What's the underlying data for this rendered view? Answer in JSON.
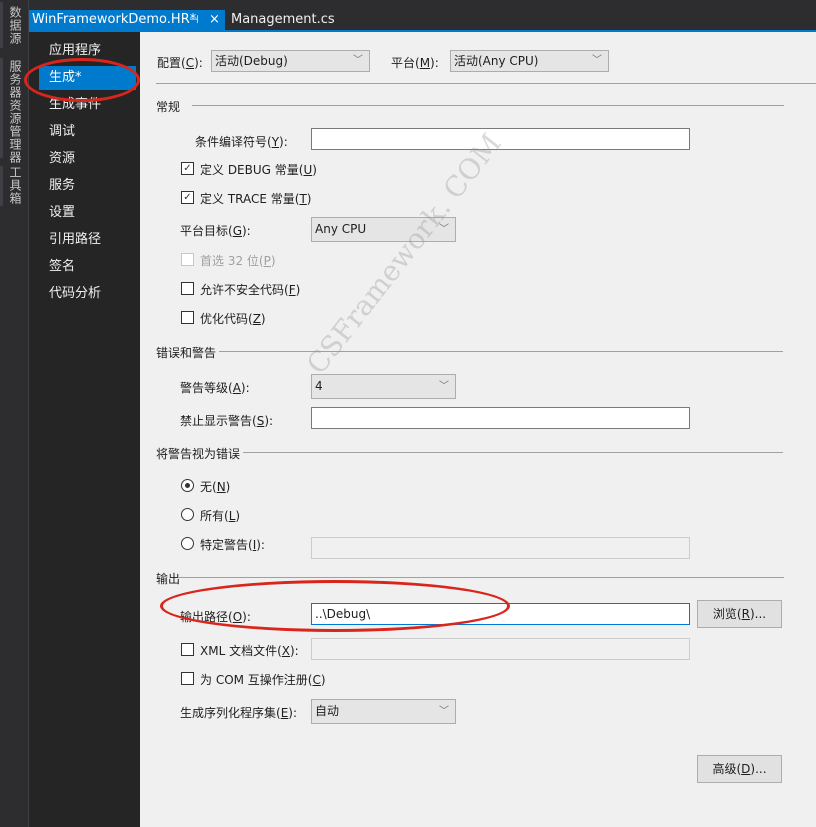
{
  "left_strip": {
    "tabs": [
      {
        "label": "数据源"
      },
      {
        "label": "服务器资源管理器"
      },
      {
        "label": "工具箱"
      }
    ]
  },
  "tabs": [
    {
      "label": "WinFrameworkDemo.HR*",
      "active": true,
      "pin_icon": "pin",
      "close_icon": "×"
    },
    {
      "label": "Management.cs",
      "active": false
    }
  ],
  "nav": {
    "items": [
      {
        "label": "应用程序"
      },
      {
        "label": "生成*",
        "active": true
      },
      {
        "label": "生成事件"
      },
      {
        "label": "调试"
      },
      {
        "label": "资源"
      },
      {
        "label": "服务"
      },
      {
        "label": "设置"
      },
      {
        "label": "引用路径"
      },
      {
        "label": "签名"
      },
      {
        "label": "代码分析"
      }
    ]
  },
  "config": {
    "config_label": "配置(",
    "config_key": "C",
    "config_suffix": "):",
    "config_value": "活动(Debug)",
    "platform_label": "平台(",
    "platform_key": "M",
    "platform_suffix": "):",
    "platform_value": "活动(Any CPU)"
  },
  "general": {
    "title": "常规",
    "symbols_label": "条件编译符号(",
    "symbols_key": "Y",
    "symbols_suffix": "):",
    "symbols_value": "",
    "debug_label": "定义 DEBUG 常量(",
    "debug_key": "U",
    "debug_checked": true,
    "trace_label": "定义 TRACE 常量(",
    "trace_key": "T",
    "trace_checked": true,
    "platform_target_label": "平台目标(",
    "platform_target_key": "G",
    "platform_target_suffix": "):",
    "platform_target_value": "Any CPU",
    "prefer32_label": "首选 32 位(",
    "prefer32_key": "P",
    "prefer32_checked": false,
    "prefer32_disabled": true,
    "unsafe_label": "允许不安全代码(",
    "unsafe_key": "F",
    "unsafe_checked": false,
    "optimize_label": "优化代码(",
    "optimize_key": "Z",
    "optimize_checked": false,
    "close_paren": ")"
  },
  "errors": {
    "title": "错误和警告",
    "level_label": "警告等级(",
    "level_key": "A",
    "level_suffix": "):",
    "level_value": "4",
    "suppress_label": "禁止显示警告(",
    "suppress_key": "S",
    "suppress_suffix": "):",
    "suppress_value": ""
  },
  "treat_warnings": {
    "title": "将警告视为错误",
    "none_label": "无(",
    "none_key": "N",
    "all_label": "所有(",
    "all_key": "L",
    "specific_label": "特定警告(",
    "specific_key": "I",
    "specific_suffix": "):",
    "specific_value": "",
    "selected": "none"
  },
  "output": {
    "title": "输出",
    "path_label": "输出路径(",
    "path_key": "O",
    "path_suffix": "):",
    "path_value": "..\\Debug\\",
    "browse_label": "浏览(",
    "browse_key": "R",
    "browse_suffix": ")...",
    "xml_label": "XML 文档文件(",
    "xml_key": "X",
    "xml_suffix": "):",
    "xml_checked": false,
    "xml_value": "",
    "com_label": "为 COM 互操作注册(",
    "com_key": "C",
    "com_checked": false,
    "serialization_label": "生成序列化程序集(",
    "serialization_key": "E",
    "serialization_suffix": "):",
    "serialization_value": "自动"
  },
  "advanced": {
    "label": "高级(",
    "key": "D",
    "suffix": ")..."
  },
  "watermark": "CSFramework. COM",
  "colors": {
    "accent": "#007acc",
    "annotation": "#d9261c"
  }
}
